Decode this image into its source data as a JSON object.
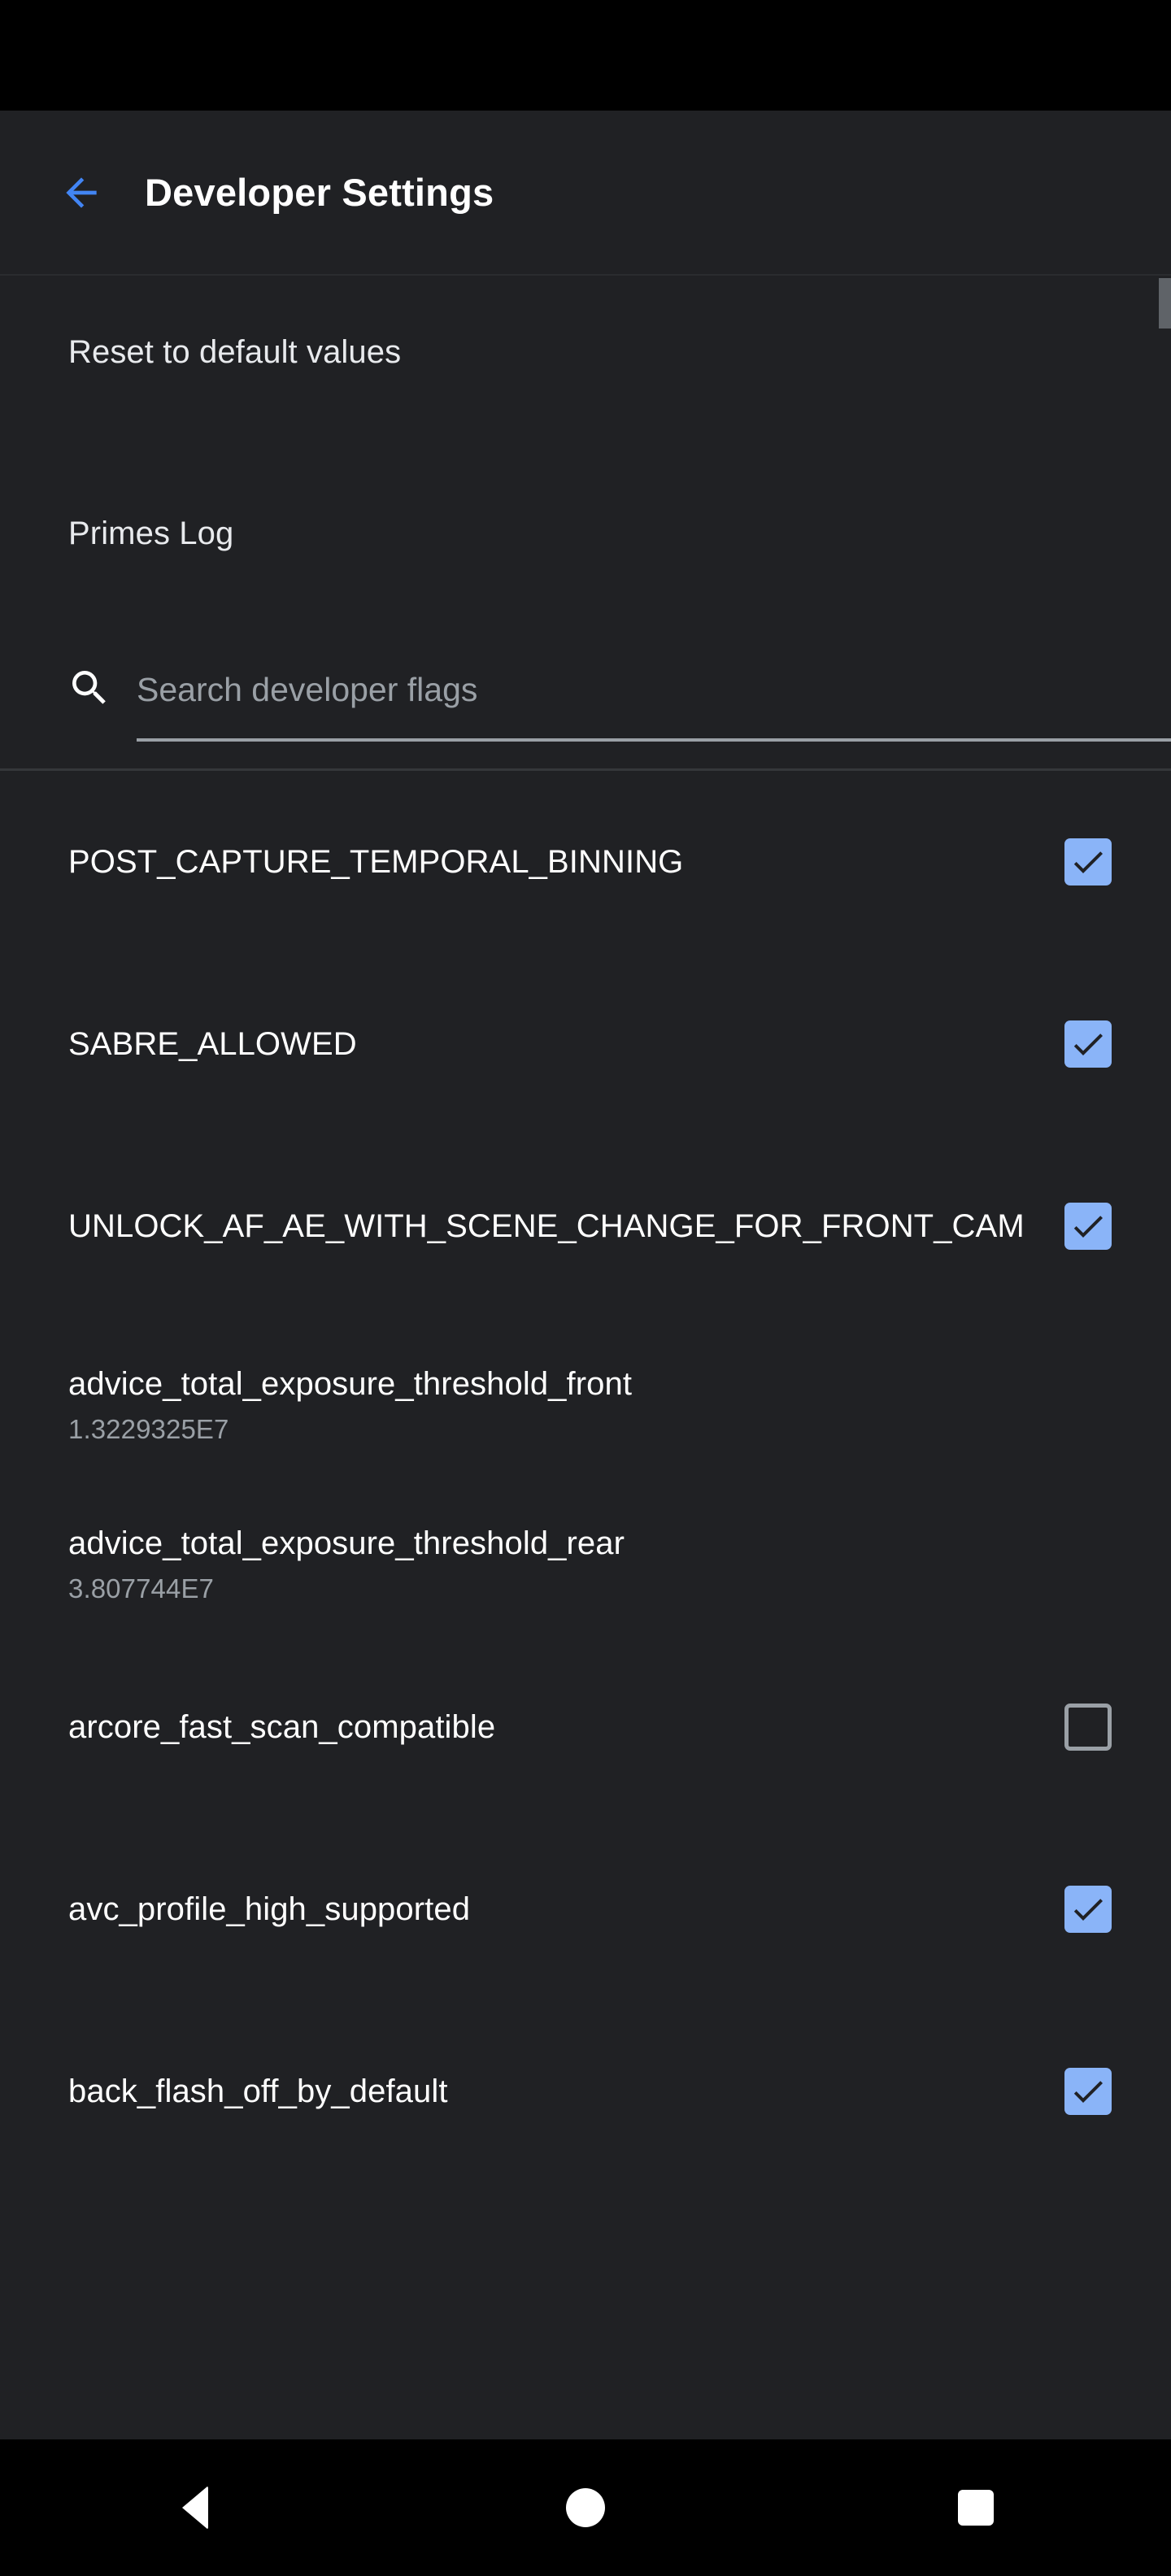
{
  "app_bar": {
    "back_icon": "arrow-left-icon",
    "title": "Developer Settings",
    "accent_color": "#4285f4"
  },
  "menu": {
    "reset_label": "Reset to default values",
    "primes_log_label": "Primes Log"
  },
  "search": {
    "icon": "search-icon",
    "placeholder": "Search developer flags",
    "value": ""
  },
  "colors": {
    "background": "#202124",
    "status_bar": "#000000",
    "nav_bar": "#000000",
    "checkbox_checked": "#8ab4f8",
    "checkbox_unchecked_border": "#9aa0a6",
    "primary_text": "#ffffff",
    "secondary_text": "#9aa0a6",
    "divider": "#35373a",
    "scrollbar": "#5f6368"
  },
  "flags": [
    {
      "name": "POST_CAPTURE_TEMPORAL_BINNING",
      "type": "checkbox",
      "checked": true,
      "value": ""
    },
    {
      "name": "SABRE_ALLOWED",
      "type": "checkbox",
      "checked": true,
      "value": ""
    },
    {
      "name": "UNLOCK_AF_AE_WITH_SCENE_CHANGE_FOR_FRONT_CAM",
      "type": "checkbox",
      "checked": true,
      "value": ""
    },
    {
      "name": "advice_total_exposure_threshold_front",
      "type": "value",
      "checked": null,
      "value": "1.3229325E7"
    },
    {
      "name": "advice_total_exposure_threshold_rear",
      "type": "value",
      "checked": null,
      "value": "3.807744E7"
    },
    {
      "name": "arcore_fast_scan_compatible",
      "type": "checkbox",
      "checked": false,
      "value": ""
    },
    {
      "name": "avc_profile_high_supported",
      "type": "checkbox",
      "checked": true,
      "value": ""
    },
    {
      "name": "back_flash_off_by_default",
      "type": "checkbox",
      "checked": true,
      "value": ""
    }
  ],
  "nav_bar": {
    "back_label": "Back",
    "home_label": "Home",
    "recents_label": "Recents"
  }
}
